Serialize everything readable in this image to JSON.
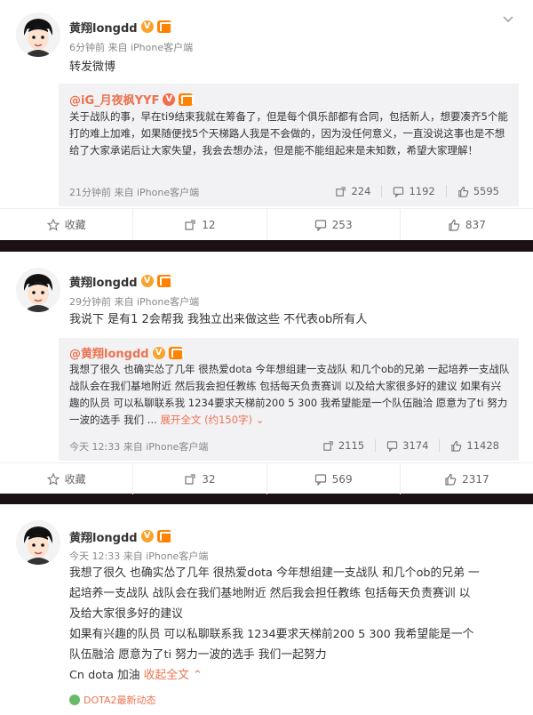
{
  "posts": [
    {
      "user": {
        "name": "黄翔longdd"
      },
      "meta": "6分钟前 来自 iPhone客户端",
      "text": "转发微博",
      "quote": {
        "user": "@iG_月夜枫YYF",
        "text": "关于战队的事，早在ti9结束我就在筹备了，但是每个俱乐部都有合同，包括新人，想要凑齐5个能打的难上加难，如果随便找5个天梯路人我是不会做的，因为没任何意义，一直没说这事也是不想给了大家承诺后让大家失望，我会去想办法，但是能不能组起来是未知数，希望大家理解！",
        "meta": "21分钟前 来自 iPhone客户端",
        "stats": {
          "repost": "224",
          "comment": "1192",
          "like": "5595"
        }
      },
      "actions": {
        "collect": "收藏",
        "repost": "12",
        "comment": "253",
        "like": "837"
      }
    },
    {
      "user": {
        "name": "黄翔longdd"
      },
      "meta": "29分钟前 来自 iPhone客户端",
      "text": "我说下 是有1 2会帮我 我独立出来做这些 不代表ob所有人",
      "quote": {
        "user": "@黄翔longdd",
        "text": "我想了很久 也确实怂了几年 很热爱dota 今年想组建一支战队 和几个ob的兄弟 一起培养一支战队  战队会在我们基地附近 然后我会担任教练 包括每天负责赛训 以及给大家很多好的建议 如果有兴趣的队员 可以私聊联系我 1234要求天梯前200 5 300  我希望能是一个队伍融洽 愿意为了ti 努力一波的选手 我们 ...",
        "expand": "展开全文",
        "expand_count": "(约150字)",
        "meta": "今天 12:33 来自 iPhone客户端",
        "stats": {
          "repost": "2115",
          "comment": "3174",
          "like": "11428"
        }
      },
      "actions": {
        "collect": "收藏",
        "repost": "32",
        "comment": "569",
        "like": "2317"
      }
    },
    {
      "user": {
        "name": "黄翔longdd"
      },
      "meta": "今天 12:33 来自 iPhone客户端",
      "text_lines": [
        "我想了很久  也确实怂了几年  很热爱dota 今年想组建一支战队  和几个ob的兄弟  一",
        "起培养一支战队    战队会在我们基地附近  然后我会担任教练  包括每天负责赛训  以",
        "及给大家很多好的建议",
        "如果有兴趣的队员  可以私聊联系我  1234要求天梯前200 5 300    我希望能是一个",
        "队伍融洽  愿意为了ti 努力一波的选手  我们一起努力"
      ],
      "last_line": "Cn dota 加油",
      "collapse": "收起全文",
      "topic": "DOTA2最新动态"
    }
  ],
  "colors": {
    "accent": "#eb7350",
    "quote_bg": "#f2f2f5",
    "page_bg": "#1b1013"
  }
}
